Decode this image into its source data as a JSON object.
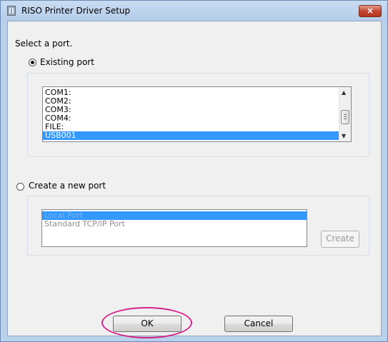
{
  "window": {
    "title": "RISO Printer Driver Setup",
    "close_glyph": "×"
  },
  "prompt": "Select a port.",
  "existing_port": {
    "label": "Existing port",
    "checked": true,
    "ports": [
      "COM1:",
      "COM2:",
      "COM3:",
      "COM4:",
      "FILE:",
      "USB001"
    ],
    "selected": "USB001"
  },
  "new_port": {
    "label": "Create a new port",
    "checked": false,
    "port_types": [
      "Local Port",
      "Standard TCP/IP Port"
    ],
    "selected": "Local Port",
    "create_label": "Create"
  },
  "buttons": {
    "ok_label": "OK",
    "cancel_label": "Cancel"
  },
  "colors": {
    "selection": "#3399ff",
    "highlight_ring": "#d6248a",
    "close_button": "#c1422b"
  },
  "icons": {
    "title": "printer-icon",
    "close": "close-icon"
  }
}
